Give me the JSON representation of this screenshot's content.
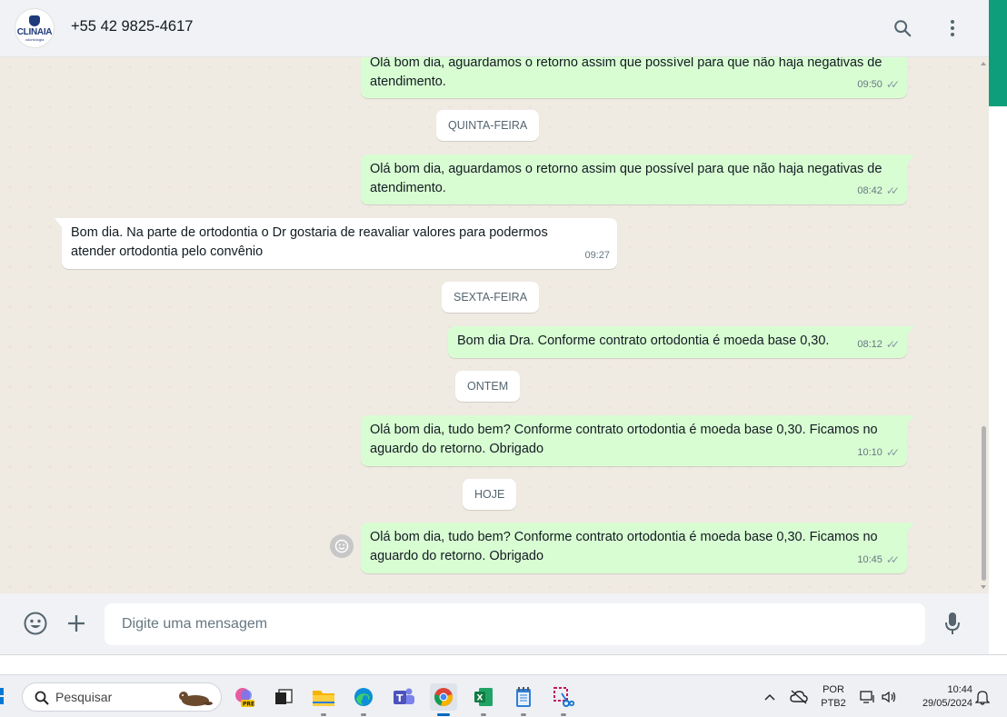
{
  "header": {
    "contact_name": "+55 42 9825-4617",
    "avatar_brand": "CLINAIA",
    "avatar_sub": "odontologia"
  },
  "messages": [
    {
      "dir": "out",
      "text": "Olá bom dia, aguardamos o retorno assim que possível para que não haja negativas de atendimento.",
      "time": "09:50",
      "ticks": "✓✓"
    },
    {
      "dir": "out",
      "text": "Olá bom dia, aguardamos o retorno assim que possível para que não haja negativas de atendimento.",
      "time": "08:42",
      "ticks": "✓✓"
    },
    {
      "dir": "in",
      "text": "Bom dia. Na parte de ortodontia o Dr gostaria de reavaliar valores para podermos atender ortodontia pelo convênio",
      "time": "09:27"
    },
    {
      "dir": "out",
      "text": "Bom dia Dra. Conforme contrato ortodontia é moeda base 0,30.",
      "time": "08:12",
      "ticks": "✓✓"
    },
    {
      "dir": "out",
      "text": "Olá bom dia, tudo bem? Conforme contrato ortodontia é moeda base 0,30. Ficamos no aguardo do retorno. Obrigado",
      "time": "10:10",
      "ticks": "✓✓"
    },
    {
      "dir": "out",
      "text": "Olá bom dia, tudo bem? Conforme contrato ortodontia é moeda base 0,30. Ficamos no aguardo do retorno. Obrigado",
      "time": "10:45",
      "ticks": "✓✓"
    }
  ],
  "day_separators": [
    "QUINTA-FEIRA",
    "SEXTA-FEIRA",
    "ONTEM",
    "HOJE"
  ],
  "composer": {
    "placeholder": "Digite uma mensagem"
  },
  "taskbar": {
    "search_label": "Pesquisar",
    "language_line1": "POR",
    "language_line2": "PTB2",
    "time": "10:44",
    "date": "29/05/2024"
  },
  "colors": {
    "outgoing_bubble": "#d9fdd3",
    "incoming_bubble": "#ffffff",
    "chat_bg": "#efeae2",
    "accent_strip": "#0e9e7c"
  }
}
